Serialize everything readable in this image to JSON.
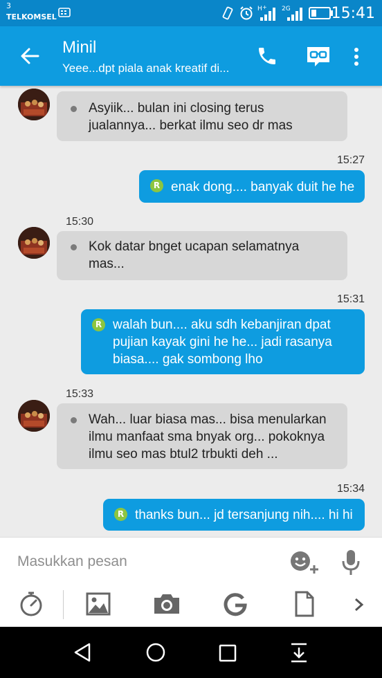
{
  "status": {
    "carrier_number": "3",
    "carrier": "TELKOMSEL",
    "time": "15:41",
    "net_type": "2G"
  },
  "header": {
    "title": "Minil",
    "subtitle": "Yeee...dpt piala anak kreatif di..."
  },
  "messages": [
    {
      "dir": "in",
      "lines": [
        "Asyiik... bulan ini closing terus",
        "jualannya... berkat ilmu seo dr mas"
      ]
    },
    {
      "dir": "out",
      "time": "15:27",
      "lines": [
        "enak dong.... banyak duit he he"
      ]
    },
    {
      "dir": "in",
      "time": "15:30",
      "lines": [
        "Kok datar bnget ucapan selamatnya",
        "mas..."
      ]
    },
    {
      "dir": "out",
      "time": "15:31",
      "lines": [
        "walah bun.... aku sdh kebanjiran dpat",
        "pujian kayak gini he he... jadi rasanya",
        "biasa.... gak sombong lho"
      ]
    },
    {
      "dir": "in",
      "time": "15:33",
      "lines": [
        "Wah... luar biasa mas... bisa menularkan",
        "ilmu manfaat sma bnyak org... pokoknya",
        "ilmu seo mas btul2 trbukti deh ..."
      ]
    },
    {
      "dir": "out",
      "time": "15:34",
      "lines": [
        "thanks bun... jd tersanjung nih.... hi hi"
      ]
    }
  ],
  "badge_letter": "R",
  "composer": {
    "placeholder": "Masukkan pesan"
  },
  "colors": {
    "primary": "#0e9ce0",
    "status_bar": "#0a86c9",
    "incoming_bubble": "#d7d7d7",
    "badge": "#8dc540"
  },
  "icons": {
    "header": [
      "back-arrow-icon",
      "phone-icon",
      "video-call-icon",
      "more-vert-icon"
    ],
    "composer": [
      "emoji-add-icon",
      "microphone-icon",
      "timer-icon",
      "image-icon",
      "camera-icon",
      "google-icon",
      "document-icon",
      "chevron-right-icon"
    ],
    "nav": [
      "nav-back-icon",
      "nav-home-icon",
      "nav-recents-icon",
      "nav-notifications-icon"
    ]
  }
}
